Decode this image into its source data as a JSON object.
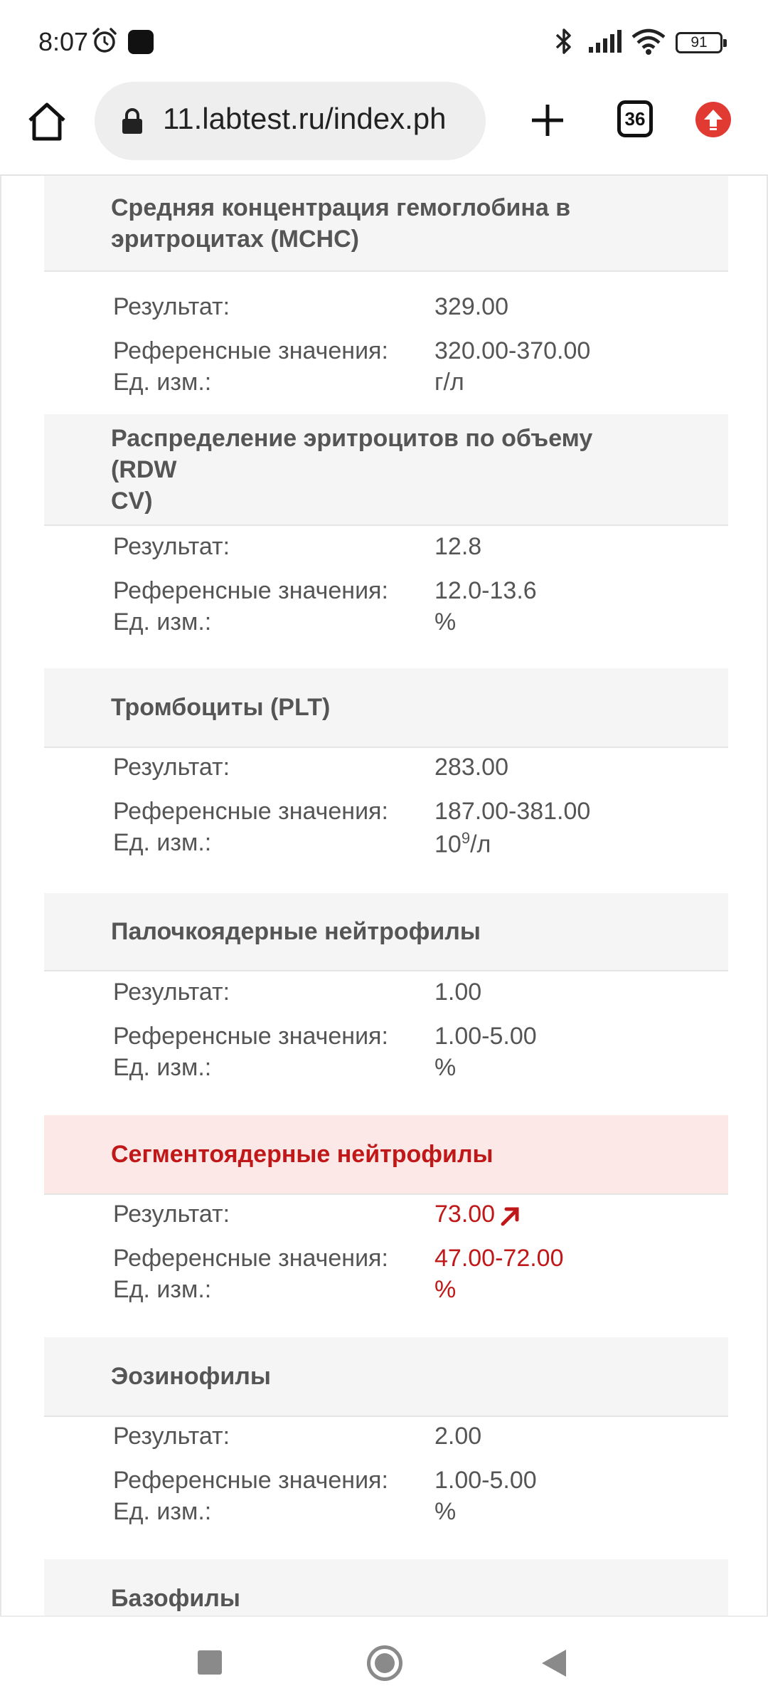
{
  "status_bar": {
    "time": "8:07",
    "battery": "91"
  },
  "browser": {
    "url": "11.labtest.ru/index.ph",
    "tab_count": "36"
  },
  "labels": {
    "result": "Результат:",
    "reference": "Референсные значения:",
    "unit": "Ед. изм.:"
  },
  "sections": [
    {
      "title_line1": "Средняя концентрация гемоглобина в",
      "title_line2": "эритроцитах (MCHC)",
      "result": "329.00",
      "reference": "320.00-370.00",
      "unit": "г/л"
    },
    {
      "title_line1": "Распределение эритроцитов по объему (RDW",
      "title_line2": "CV)",
      "result": "12.8",
      "reference": "12.0-13.6",
      "unit": "%"
    },
    {
      "title": "Тромбоциты (PLT)",
      "result": "283.00",
      "reference": "187.00-381.00",
      "unit_base": "10",
      "unit_sup": "9",
      "unit_tail": "/л"
    },
    {
      "title": "Палочкоядерные нейтрофилы",
      "result": "1.00",
      "reference": "1.00-5.00",
      "unit": "%"
    },
    {
      "title": "Сегментоядерные нейтрофилы",
      "result": "73.00",
      "reference": "47.00-72.00",
      "unit": "%",
      "flag": "above-range"
    },
    {
      "title": "Эозинофилы",
      "result": "2.00",
      "reference": "1.00-5.00",
      "unit": "%"
    },
    {
      "title": "Базофилы"
    }
  ],
  "colors": {
    "alert": "#c01818",
    "alert_bg": "#fde8e8",
    "section_bg": "#f5f5f5"
  }
}
